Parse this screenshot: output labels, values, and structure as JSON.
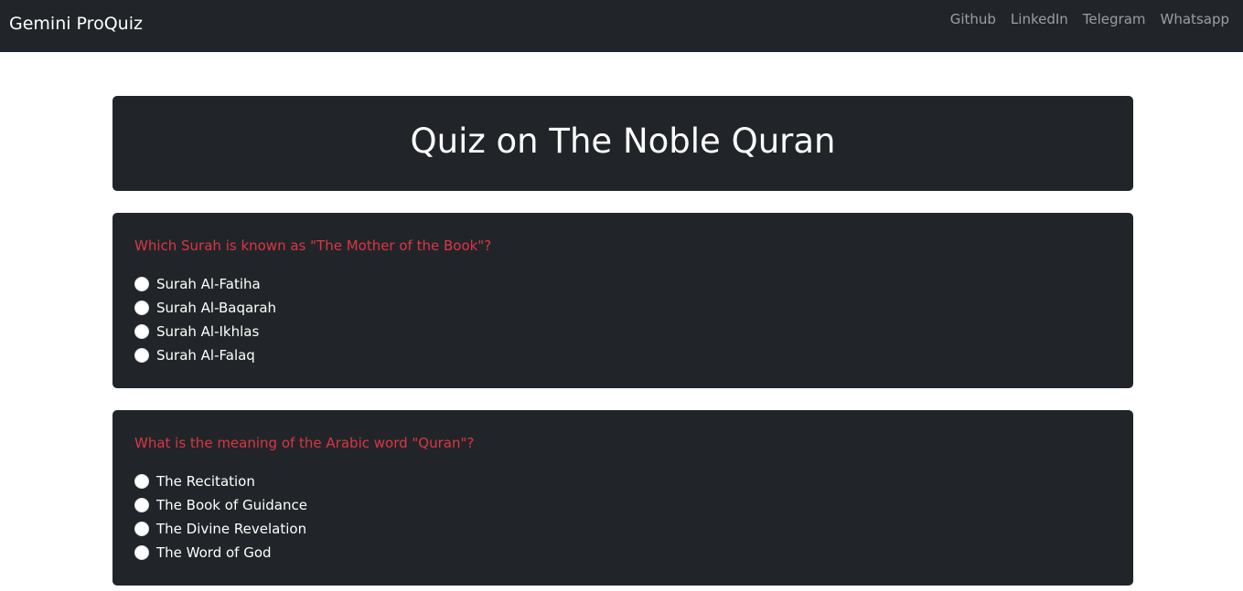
{
  "navbar": {
    "brand": "Gemini ProQuiz",
    "links": [
      "Github",
      "LinkedIn",
      "Telegram",
      "Whatsapp"
    ]
  },
  "page": {
    "title": "Quiz on The Noble Quran"
  },
  "questions": [
    {
      "text": "Which Surah is known as \"The Mother of the Book\"?",
      "options": [
        "Surah Al-Fatiha",
        "Surah Al-Baqarah",
        "Surah Al-Ikhlas",
        "Surah Al-Falaq"
      ]
    },
    {
      "text": "What is the meaning of the Arabic word \"Quran\"?",
      "options": [
        "The Recitation",
        "The Book of Guidance",
        "The Divine Revelation",
        "The Word of God"
      ]
    }
  ],
  "colors": {
    "dark": "#212529",
    "question": "#dc3545",
    "nav_link": "#8c8e90"
  }
}
